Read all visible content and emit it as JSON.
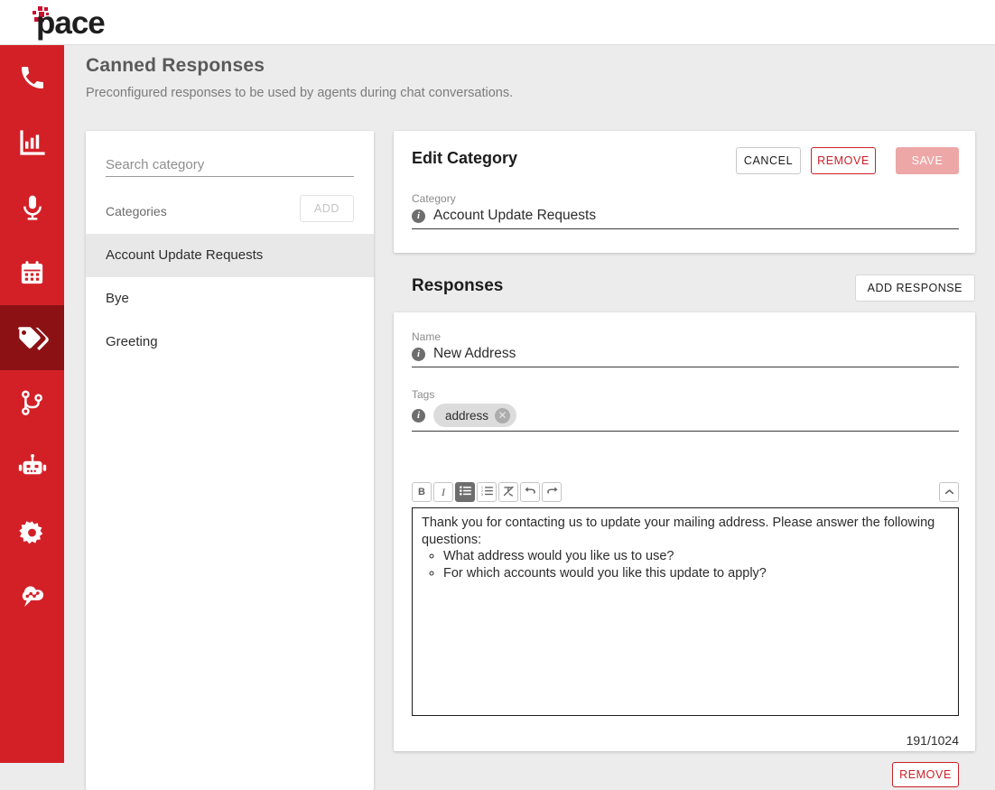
{
  "brand": {
    "name": "pace",
    "logo_color": "#c8102e"
  },
  "rail": {
    "bg_color": "#d32027",
    "active_color": "#8c1114",
    "items": [
      {
        "icon": "phone-icon",
        "active": false
      },
      {
        "icon": "bar-chart-icon",
        "active": false
      },
      {
        "icon": "microphone-icon",
        "active": false
      },
      {
        "icon": "calendar-icon",
        "active": false
      },
      {
        "icon": "tags-icon",
        "active": true
      },
      {
        "icon": "flow-branch-icon",
        "active": false
      },
      {
        "icon": "robot-icon",
        "active": false
      },
      {
        "icon": "gear-icon",
        "active": false
      },
      {
        "icon": "cloud-chat-network-icon",
        "active": false
      }
    ]
  },
  "page": {
    "title": "Canned Responses",
    "subtitle": "Preconfigured responses to be used by agents during chat conversations."
  },
  "categories_panel": {
    "search_placeholder": "Search category",
    "search_value": "",
    "list_label": "Categories",
    "add_label": "ADD",
    "items": [
      {
        "label": "Account Update Requests",
        "selected": true
      },
      {
        "label": "Bye",
        "selected": false
      },
      {
        "label": "Greeting",
        "selected": false
      }
    ]
  },
  "edit_category": {
    "title": "Edit Category",
    "cancel_label": "CANCEL",
    "remove_label": "REMOVE",
    "save_label": "SAVE",
    "field_label": "Category",
    "field_value": "Account Update Requests"
  },
  "responses": {
    "title": "Responses",
    "add_label": "ADD RESPONSE",
    "name_label": "Name",
    "name_value": "New Address",
    "tags_label": "Tags",
    "tags": [
      {
        "label": "address"
      }
    ],
    "toolbar": [
      {
        "icon": "bold-icon",
        "label": "B",
        "active": false
      },
      {
        "icon": "italic-icon",
        "label": "I",
        "active": false
      },
      {
        "icon": "unordered-list-icon",
        "label": "",
        "active": true
      },
      {
        "icon": "ordered-list-icon",
        "label": "",
        "active": false
      },
      {
        "icon": "clear-formatting-icon",
        "label": "",
        "active": false
      },
      {
        "icon": "undo-icon",
        "label": "",
        "active": false
      },
      {
        "icon": "redo-icon",
        "label": "",
        "active": false
      }
    ],
    "collapse_icon": "chevron-up-icon",
    "body_paragraph": "Thank you for contacting us to update your mailing address. Please answer the following questions:",
    "body_bullets": [
      "What address would you like us to use?",
      "For which accounts would you like this update to apply?"
    ],
    "counter": "191/1024",
    "remove_label": "REMOVE"
  }
}
